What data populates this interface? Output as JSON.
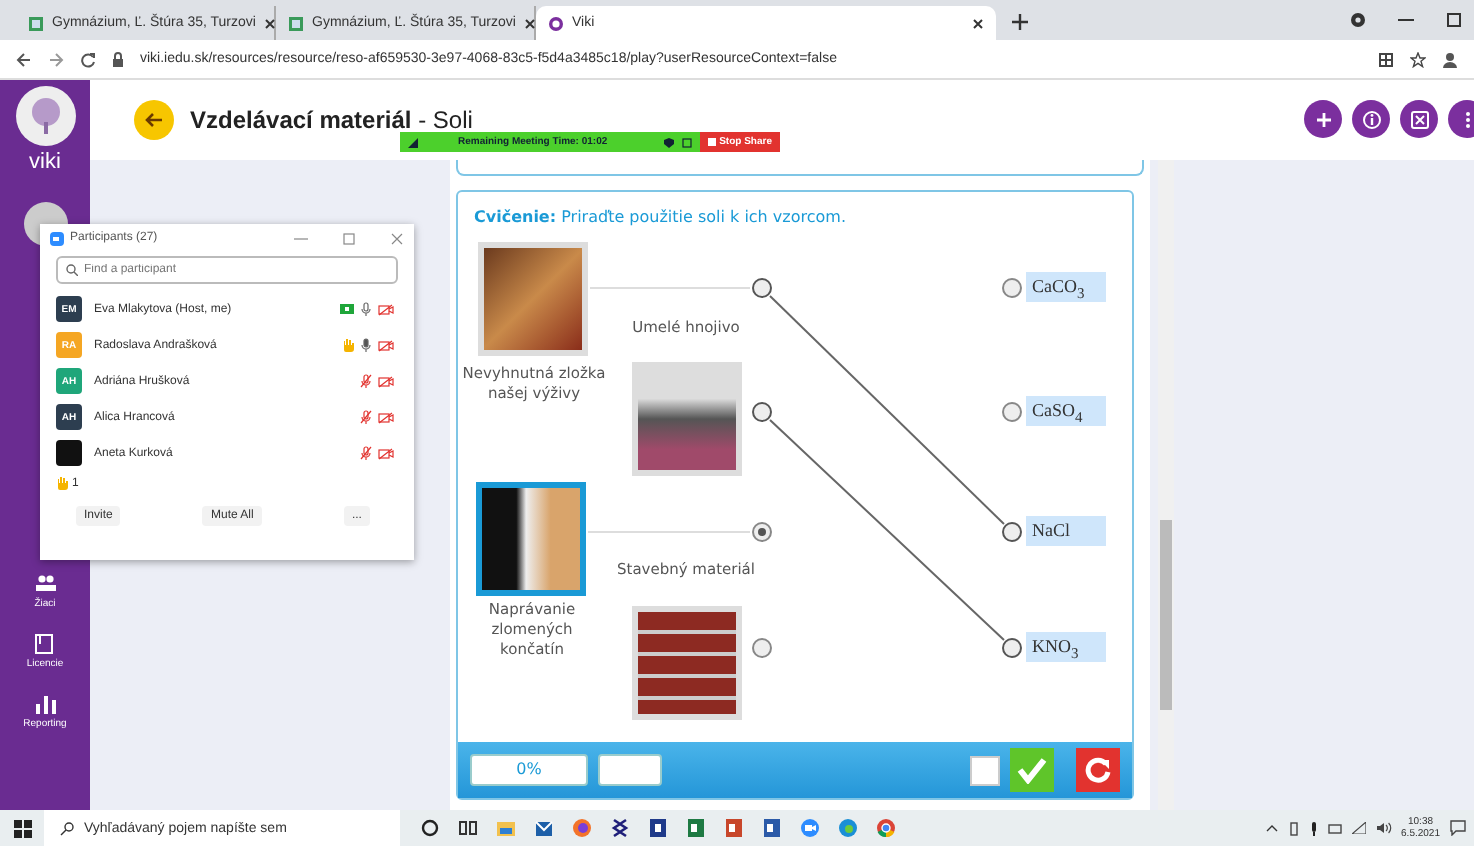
{
  "browser": {
    "tabs": [
      {
        "title": "Gymnázium, Ľ. Štúra 35, Turzovi",
        "selected": false
      },
      {
        "title": "Gymnázium, Ľ. Štúra 35, Turzovi",
        "selected": false
      },
      {
        "title": "Viki",
        "selected": true
      }
    ],
    "url": "viki.iedu.sk/resources/resource/reso-af659530-3e97-4068-83c5-f5d4a3485c18/play?userResourceContext=false"
  },
  "app": {
    "logo": "viki",
    "title": "Vzdelávací materiál",
    "subtitle": "- Soli",
    "sidebar": [
      {
        "label": "Žiaci"
      },
      {
        "label": "Licencie"
      },
      {
        "label": "Reporting"
      }
    ]
  },
  "meeting_bar": {
    "text": "Remaining Meeting Time: 01:02",
    "stop_label": "Stop Share"
  },
  "participants": {
    "title": "Participants (27)",
    "search": {
      "placeholder": "Find a participant"
    },
    "people": [
      {
        "initials": "EM",
        "name": "Eva Mlakytova (Host, me)",
        "color": "#2d3e50",
        "sharing": true,
        "hand_raised": false,
        "muted": false
      },
      {
        "initials": "RA",
        "name": "Radoslava Andrašková",
        "color": "#f5a623",
        "sharing": false,
        "hand_raised": true,
        "muted": false
      },
      {
        "initials": "AH",
        "name": "Adriána Hrušková",
        "color": "#1fa67a",
        "sharing": false,
        "hand_raised": false,
        "muted": true
      },
      {
        "initials": "AH",
        "name": "Alica Hrancová",
        "color": "#2d3e50",
        "sharing": false,
        "hand_raised": false,
        "muted": true
      },
      {
        "name": "Aneta Kurková",
        "color": "#111111",
        "sharing": false,
        "hand_raised": false,
        "muted": true
      }
    ],
    "raised_count": "1",
    "buttons": [
      "Invite",
      "Mute All",
      "..."
    ]
  },
  "exercise": {
    "instruction": "**Cvičenie:** Priraďte použitie soli k ich vzorcom.",
    "left_items": [
      {
        "label": "Nevyhnutná zložka našej výživy",
        "kind": "outer",
        "selected": false,
        "connected": true
      },
      {
        "label": "Umelé hnojivo",
        "kind": "inner",
        "selected": false,
        "connected": true
      },
      {
        "label": "Naprávanie zlomených končatín",
        "kind": "outer",
        "selected": true,
        "connected": false
      },
      {
        "label": "Stavebný materiál",
        "kind": "inner",
        "selected": false,
        "connected": false
      }
    ],
    "right_items": [
      {
        "formula": "CaCO$_{3}$",
        "connected": false
      },
      {
        "formula": "CaSO$_{4}$",
        "connected": false
      },
      {
        "formula": "NaCl",
        "connected": true
      },
      {
        "formula": "KNO$_{3}$",
        "connected": true
      }
    ],
    "score": "0%",
    "option_checked": false
  },
  "taskbar": {
    "search_placeholder": "Vyhľadávaný pojem napíšte sem",
    "time": "10:38",
    "date": "6.5.2021"
  }
}
